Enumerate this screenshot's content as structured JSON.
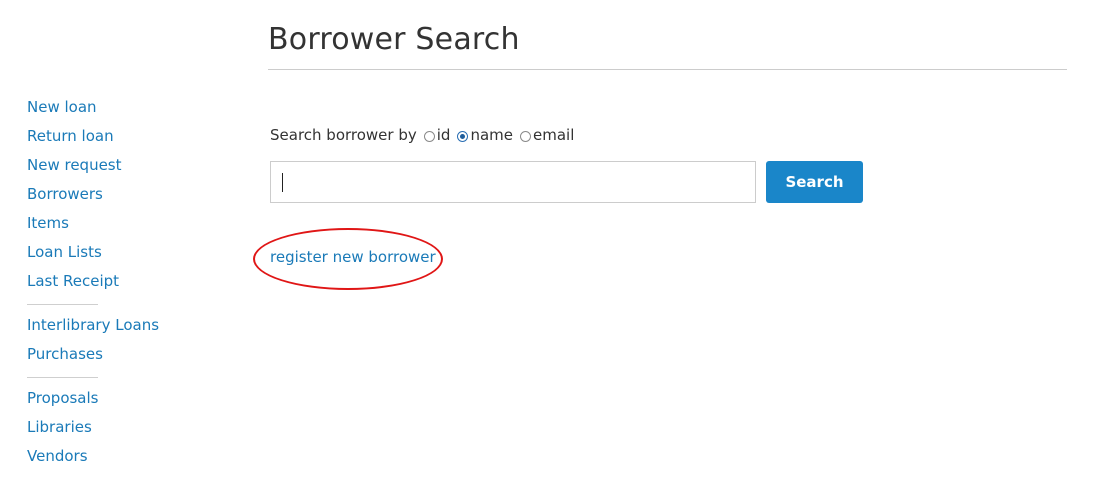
{
  "page": {
    "title": "Borrower Search"
  },
  "sidebar": {
    "groups": [
      [
        "New loan",
        "Return loan",
        "New request",
        "Borrowers",
        "Items",
        "Loan Lists",
        "Last Receipt"
      ],
      [
        "Interlibrary Loans",
        "Purchases"
      ],
      [
        "Proposals",
        "Libraries",
        "Vendors"
      ]
    ]
  },
  "search": {
    "label": "Search borrower by",
    "options": [
      "id",
      "name",
      "email"
    ],
    "selected": "name",
    "input_value": "",
    "button_label": "Search"
  },
  "register_link": "register new borrower",
  "colors": {
    "link": "#1a7ab8",
    "button": "#1a86c9",
    "annotation": "#e01616"
  }
}
